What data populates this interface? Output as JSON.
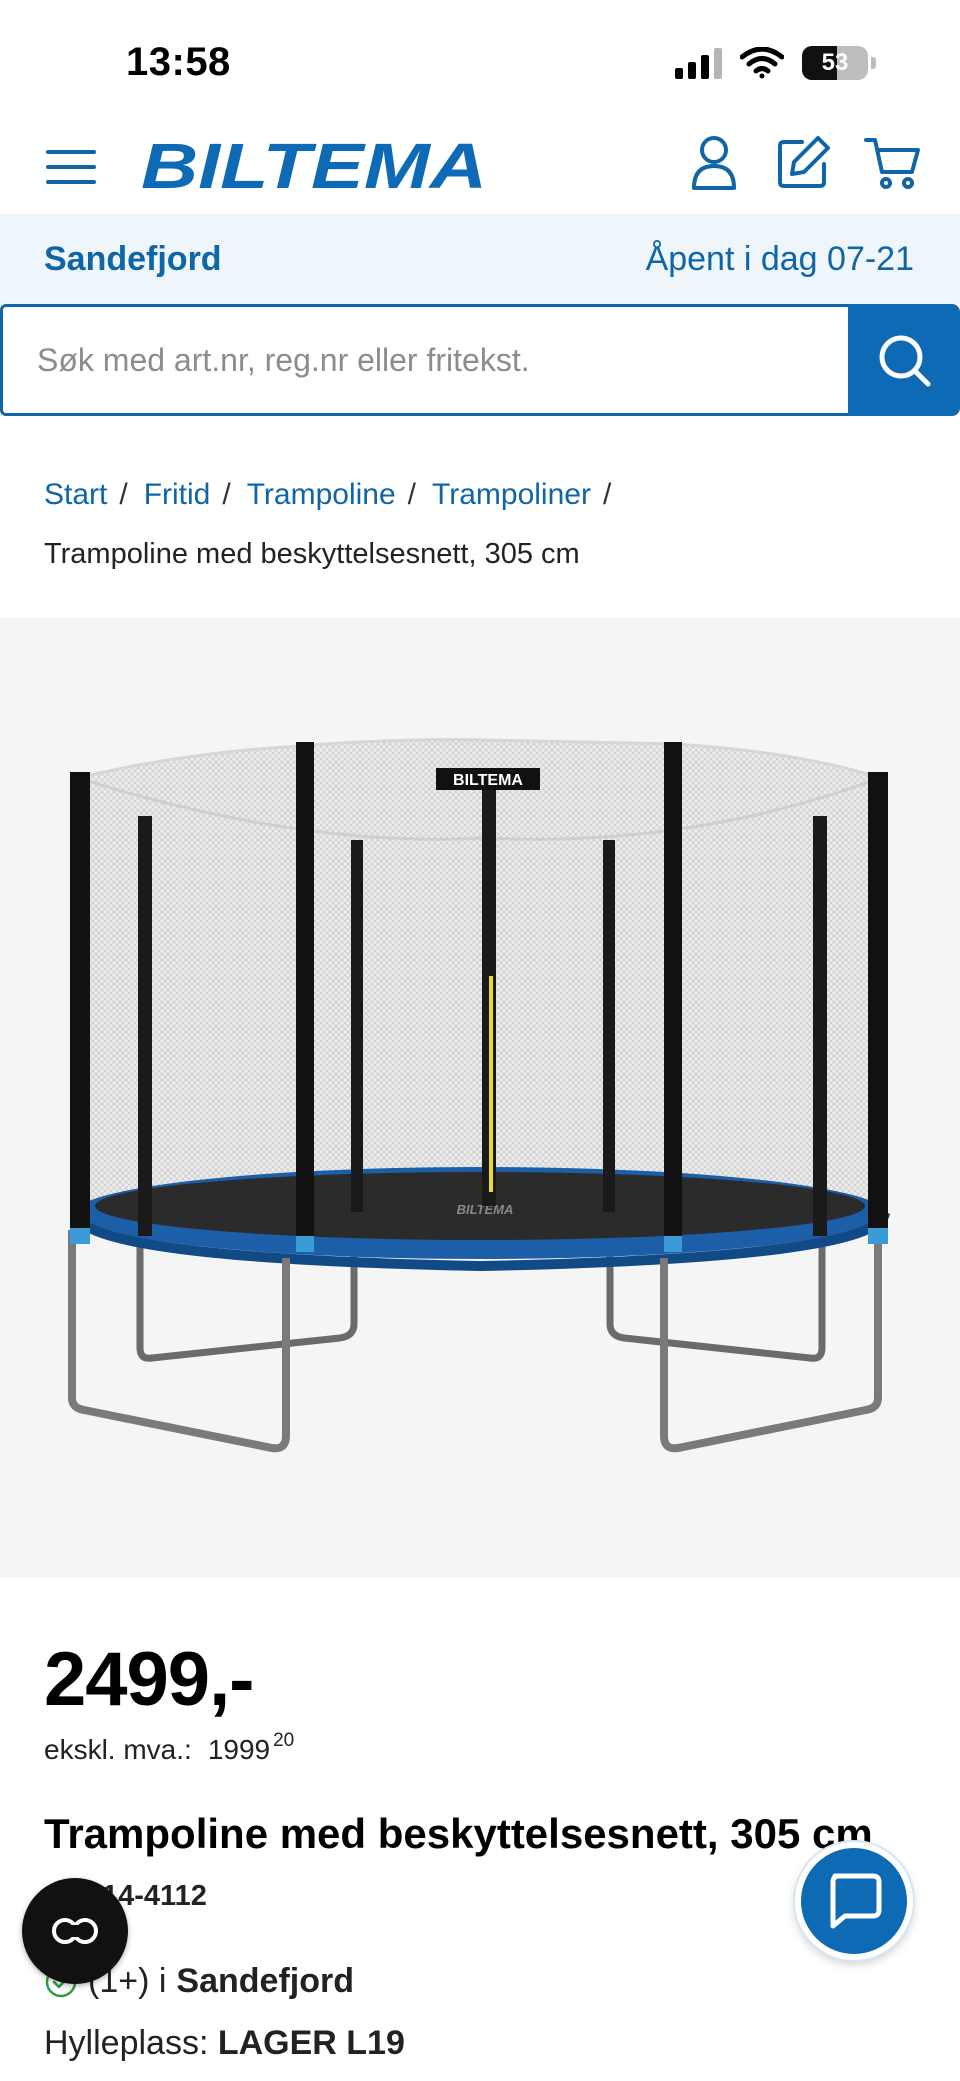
{
  "status_bar": {
    "time": "13:58",
    "battery": "53",
    "battery_level": 0.53
  },
  "header": {
    "logo_text": "BILTEMA"
  },
  "store": {
    "name": "Sandefjord",
    "hours": "Åpent i dag 07-21"
  },
  "search": {
    "placeholder": "Søk med art.nr, reg.nr eller fritekst."
  },
  "breadcrumb": {
    "items": [
      "Start",
      "Fritid",
      "Trampoline",
      "Trampoliner"
    ],
    "separator": "/",
    "current": "Trampoline med beskyttelsesnett, 305 cm"
  },
  "product_image": {
    "brand_label": "BILTEMA",
    "mat_label": "BILTEMA"
  },
  "product": {
    "price": "2499,-",
    "vat_label": "ekskl. mva.:",
    "vat_value": "1999",
    "vat_decimals": "20",
    "title": "Trampoline med beskyttelsesnett, 305 cm",
    "art_nr": "Art. 14-4112",
    "stock_count": "(1+) i",
    "stock_store": "Sandefjord",
    "shelf_label": "Hylleplass:",
    "shelf_value": "LAGER L19"
  },
  "colors": {
    "brand_blue": "#1065a7",
    "accent_blue": "#0e6ab5",
    "store_bar_bg": "#eef6fb",
    "stock_green": "#2e9e44"
  },
  "icons": [
    "menu-icon",
    "user-icon",
    "edit-icon",
    "cart-icon",
    "search-icon",
    "check-icon",
    "cookie-icon",
    "chat-icon"
  ]
}
